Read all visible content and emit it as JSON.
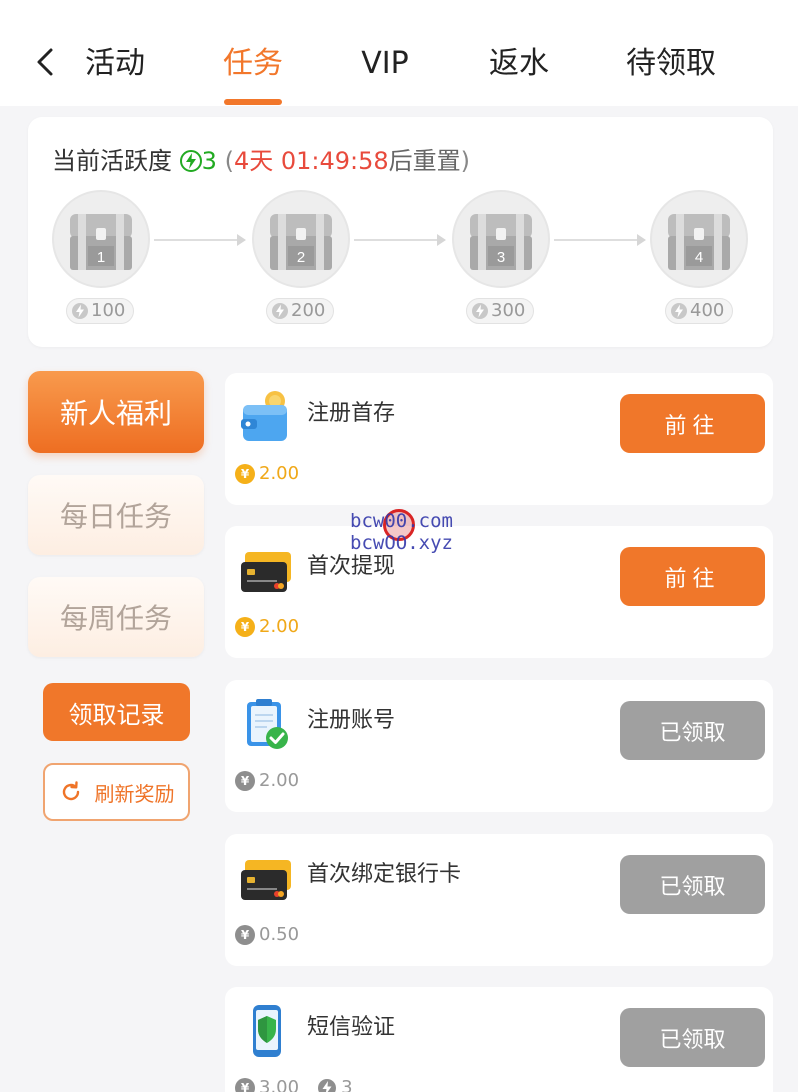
{
  "nav": {
    "tabs": [
      "活动",
      "任务",
      "VIP",
      "返水",
      "待领取"
    ],
    "active_tab": "任务"
  },
  "activity": {
    "label": "当前活跃度",
    "score": "3",
    "open_paren": "(",
    "timer": "4天 01:49:58",
    "reset_text": "后重置",
    "close_paren": ")",
    "chests": [
      {
        "number": "1",
        "requirement": "100"
      },
      {
        "number": "2",
        "requirement": "200"
      },
      {
        "number": "3",
        "requirement": "300"
      },
      {
        "number": "4",
        "requirement": "400"
      }
    ]
  },
  "categories": {
    "new_user": "新人福利",
    "daily": "每日任务",
    "weekly": "每周任务",
    "active": "新人福利"
  },
  "actions": {
    "record": "领取记录",
    "refresh": "刷新奖励"
  },
  "tasks": [
    {
      "name": "注册首存",
      "reward": "2.00",
      "status": "前往",
      "icon": "wallet-icon",
      "state": "go"
    },
    {
      "name": "首次提现",
      "reward": "2.00",
      "status": "前往",
      "icon": "bank-card-icon",
      "state": "go"
    },
    {
      "name": "注册账号",
      "reward": "2.00",
      "status": "已领取",
      "icon": "clipboard-check-icon",
      "state": "done"
    },
    {
      "name": "首次绑定银行卡",
      "reward": "0.50",
      "status": "已领取",
      "icon": "bank-card-icon",
      "state": "done"
    },
    {
      "name": "短信验证",
      "reward": "3.00",
      "activity_points": "3",
      "status": "已领取",
      "icon": "phone-shield-icon",
      "state": "done"
    }
  ],
  "watermark": {
    "line1": "bcw00.com",
    "line2": "bcwOO.xyz"
  },
  "colors": {
    "accent": "#f2772b",
    "timer": "#e84a3c",
    "score": "#22aa22",
    "done": "#a0a0a0",
    "coin": "#f5b019"
  }
}
